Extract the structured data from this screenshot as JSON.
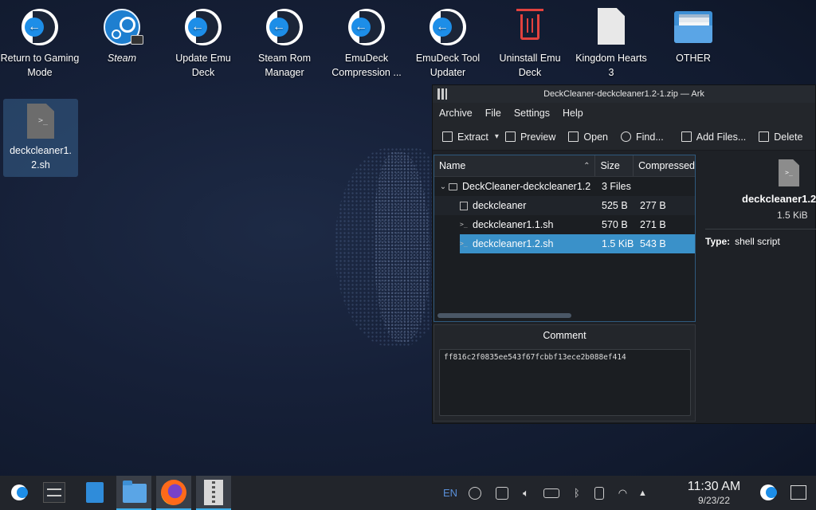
{
  "desktop": {
    "icons": [
      {
        "label": "Return to Gaming Mode"
      },
      {
        "label": "Steam"
      },
      {
        "label": "Update Emu Deck"
      },
      {
        "label": "Steam Rom Manager"
      },
      {
        "label": "EmuDeck Compression ..."
      },
      {
        "label": "EmuDeck Tool Updater"
      },
      {
        "label": "Uninstall Emu Deck"
      },
      {
        "label": "Kingdom Hearts 3"
      },
      {
        "label": "OTHER"
      }
    ],
    "selected_file": {
      "label": "deckcleaner1.2.sh"
    }
  },
  "ark": {
    "title": "DeckCleaner-deckcleaner1.2-1.zip — Ark",
    "menu": [
      "Archive",
      "File",
      "Settings",
      "Help"
    ],
    "toolbar": {
      "extract": "Extract",
      "preview": "Preview",
      "open": "Open",
      "find": "Find...",
      "add_files": "Add Files...",
      "delete": "Delete"
    },
    "columns": {
      "name": "Name",
      "size": "Size",
      "compressed": "Compressed"
    },
    "rows": [
      {
        "name": "DeckCleaner-deckcleaner1.2",
        "size": "3 Files",
        "compressed": ""
      },
      {
        "name": "deckcleaner",
        "size": "525 B",
        "compressed": "277 B"
      },
      {
        "name": "deckcleaner1.1.sh",
        "size": "570 B",
        "compressed": "271 B"
      },
      {
        "name": "deckcleaner1.2.sh",
        "size": "1.5 KiB",
        "compressed": "543 B"
      }
    ],
    "comment": {
      "title": "Comment",
      "text": "ff816c2f0835ee543f67fcbbf13ece2b088ef414"
    },
    "details": {
      "name": "deckcleaner1.2",
      "size": "1.5 KiB",
      "type_label": "Type:",
      "type_value": "shell script"
    }
  },
  "taskbar": {
    "lang": "EN",
    "time": "11:30 AM",
    "date": "9/23/22"
  },
  "colors": {
    "accent": "#3daee9",
    "selection": "#3a91c9",
    "window_bg": "#1e2126",
    "taskbar_bg": "#22252b"
  }
}
